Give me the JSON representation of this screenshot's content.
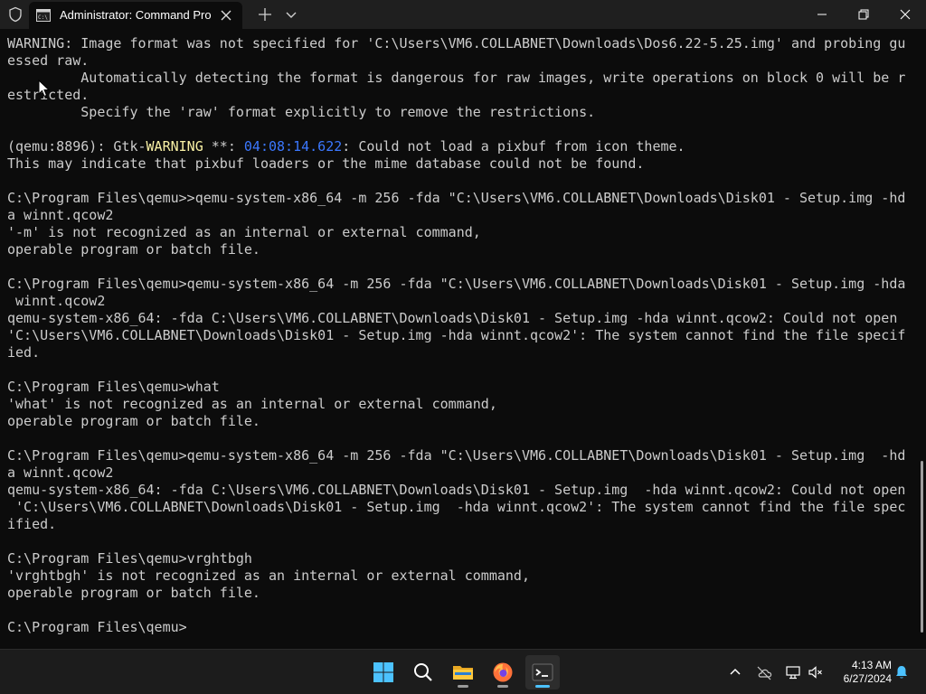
{
  "window": {
    "tab_title": "Administrator: Command Pro",
    "colors": {
      "titlebar": "#1f1f1f",
      "terminal_bg": "#0c0c0c",
      "text": "#cccccc",
      "warning_text": "#f9f1a5",
      "timestamp_text": "#3b78ff",
      "accent": "#4cc2ff"
    }
  },
  "terminal": {
    "block1": "WARNING: Image format was not specified for 'C:\\Users\\VM6.COLLABNET\\Downloads\\Dos6.22-5.25.img' and probing gu\nessed raw.\n         Automatically detecting the format is dangerous for raw images, write operations on block 0 will be r\nestricted.\n         Specify the 'raw' format explicitly to remove the restrictions.\n\n(qemu:8896): Gtk-",
    "warn_word": "WARNING",
    "after_warn": " **: ",
    "timestamp": "04:08:14.622",
    "block2": ": Could not load a pixbuf from icon theme.\nThis may indicate that pixbuf loaders or the mime database could not be found.\n\nC:\\Program Files\\qemu>>qemu-system-x86_64 -m 256 -fda \"C:\\Users\\VM6.COLLABNET\\Downloads\\Disk01 - Setup.img -hd\na winnt.qcow2\n'-m' is not recognized as an internal or external command,\noperable program or batch file.\n\nC:\\Program Files\\qemu>qemu-system-x86_64 -m 256 -fda \"C:\\Users\\VM6.COLLABNET\\Downloads\\Disk01 - Setup.img -hda\n winnt.qcow2\nqemu-system-x86_64: -fda C:\\Users\\VM6.COLLABNET\\Downloads\\Disk01 - Setup.img -hda winnt.qcow2: Could not open\n'C:\\Users\\VM6.COLLABNET\\Downloads\\Disk01 - Setup.img -hda winnt.qcow2': The system cannot find the file specif\nied.\n\nC:\\Program Files\\qemu>what\n'what' is not recognized as an internal or external command,\noperable program or batch file.\n\nC:\\Program Files\\qemu>qemu-system-x86_64 -m 256 -fda \"C:\\Users\\VM6.COLLABNET\\Downloads\\Disk01 - Setup.img  -hd\na winnt.qcow2\nqemu-system-x86_64: -fda C:\\Users\\VM6.COLLABNET\\Downloads\\Disk01 - Setup.img  -hda winnt.qcow2: Could not open\n 'C:\\Users\\VM6.COLLABNET\\Downloads\\Disk01 - Setup.img  -hda winnt.qcow2': The system cannot find the file spec\nified.\n\nC:\\Program Files\\qemu>vrghtbgh\n'vrghtbgh' is not recognized as an internal or external command,\noperable program or batch file.\n\nC:\\Program Files\\qemu>"
  },
  "taskbar": {
    "apps": [
      "start-icon",
      "search-icon",
      "file-explorer-icon",
      "firefox-icon",
      "terminal-icon"
    ],
    "tray": [
      "chevron-up-icon",
      "cloud-offline-icon",
      "network-icon",
      "volume-muted-icon",
      "notification-bell-icon"
    ]
  },
  "clock": {
    "time": "4:13 AM",
    "date": "6/27/2024"
  }
}
